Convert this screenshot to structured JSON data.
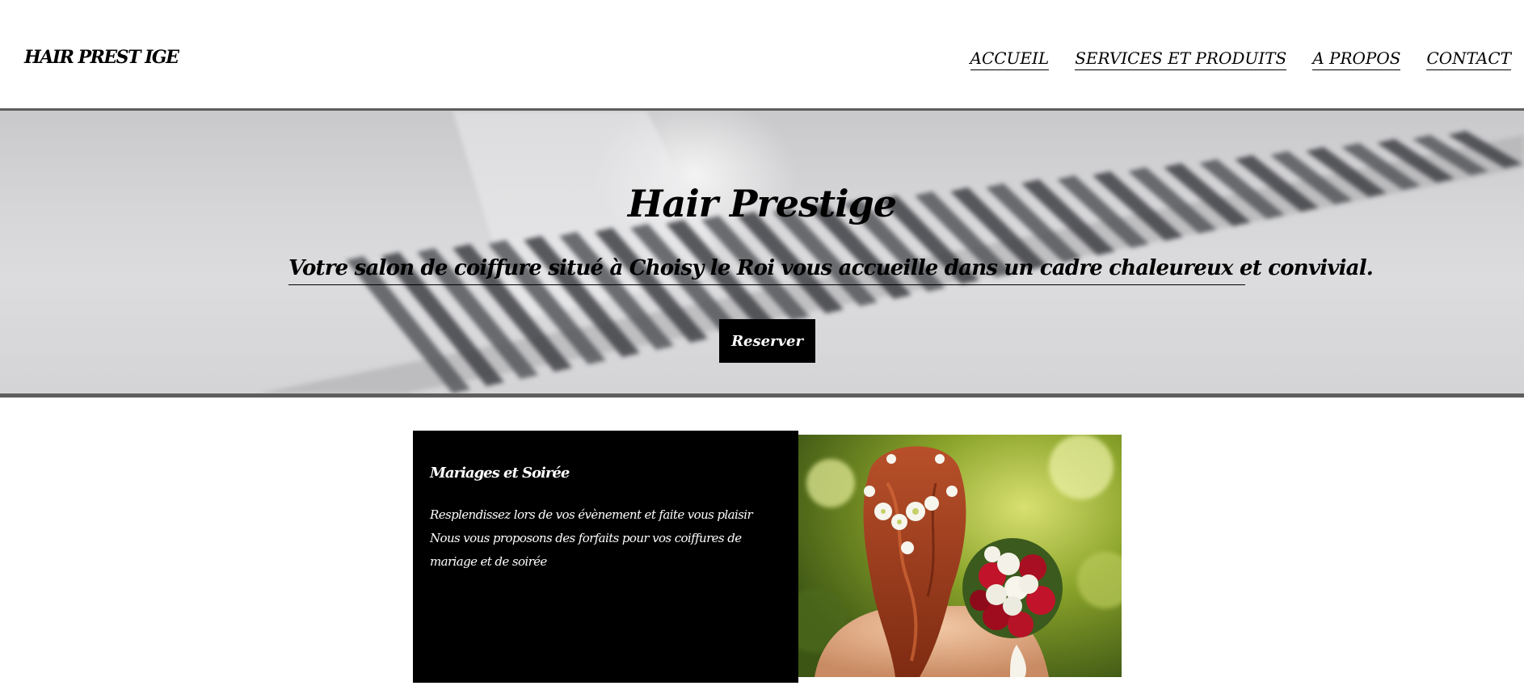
{
  "header": {
    "brand": "HAIR PREST IGE",
    "nav": [
      {
        "label": "ACCUEIL"
      },
      {
        "label": "SERVICES ET PRODUITS"
      },
      {
        "label": "A PROPOS"
      },
      {
        "label": "CONTACT"
      }
    ]
  },
  "hero": {
    "title": "Hair Prestige",
    "subtitle": "Votre salon de coiffure situé à Choisy le Roi vous accueille dans un cadre chaleureux et convivial.",
    "cta_label": "Reserver"
  },
  "services": [
    {
      "title": "Mariages et Soirée",
      "description": "Resplendissez lors de vos évènement et faite vous plaisir Nous vous proposons des forfaits pour vos coiffures de mariage et de soirée"
    }
  ],
  "colors": {
    "text": "#000000",
    "background": "#ffffff",
    "card_background": "#000000",
    "hero_border": "#5e5e5e"
  }
}
